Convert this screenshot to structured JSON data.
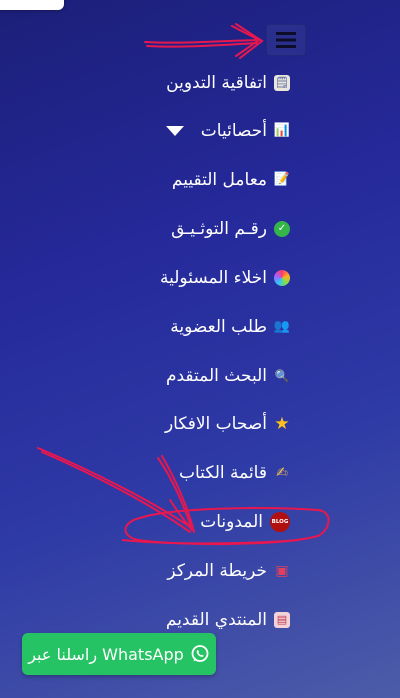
{
  "header": {
    "menu_button_icon": "hamburger-menu-icon"
  },
  "menu": {
    "items": [
      {
        "label": "اتفاقية التدوين",
        "icon": "document-icon",
        "glyph": "🗒"
      },
      {
        "label": "أحصائيات",
        "icon": "bar-chart-icon",
        "glyph": "📊",
        "has_dropdown": true
      },
      {
        "label": "معامل التقييم",
        "icon": "memo-icon",
        "glyph": "📝"
      },
      {
        "label": "رقـم التوثـيـق",
        "icon": "check-badge-icon",
        "glyph": "✓"
      },
      {
        "label": "اخلاء المسئولية",
        "icon": "color-wheel-icon",
        "glyph": "●"
      },
      {
        "label": "طلب العضوية",
        "icon": "people-icon",
        "glyph": "👥"
      },
      {
        "label": "البحث المتقدم",
        "icon": "magnifier-icon",
        "glyph": "🔍"
      },
      {
        "label": "أصحاب الافكار",
        "icon": "star-icon",
        "glyph": "★"
      },
      {
        "label": "قائمة الكتاب",
        "icon": "writer-icon",
        "glyph": "✍"
      },
      {
        "label": "المدونات",
        "icon": "blog-icon",
        "badge": "BLOG"
      },
      {
        "label": "خريطة المركز",
        "icon": "map-icon",
        "glyph": "▣"
      },
      {
        "label": "المنتدي القديم",
        "icon": "forum-icon",
        "glyph": "▤"
      }
    ]
  },
  "whatsapp": {
    "label": "راسلنا عبر WhatsApp",
    "icon": "whatsapp-icon",
    "color": "#25c363"
  },
  "colors": {
    "background_top": "#1c1f78",
    "background_bottom": "#4d5ca8",
    "annotation": "#e8174f"
  }
}
